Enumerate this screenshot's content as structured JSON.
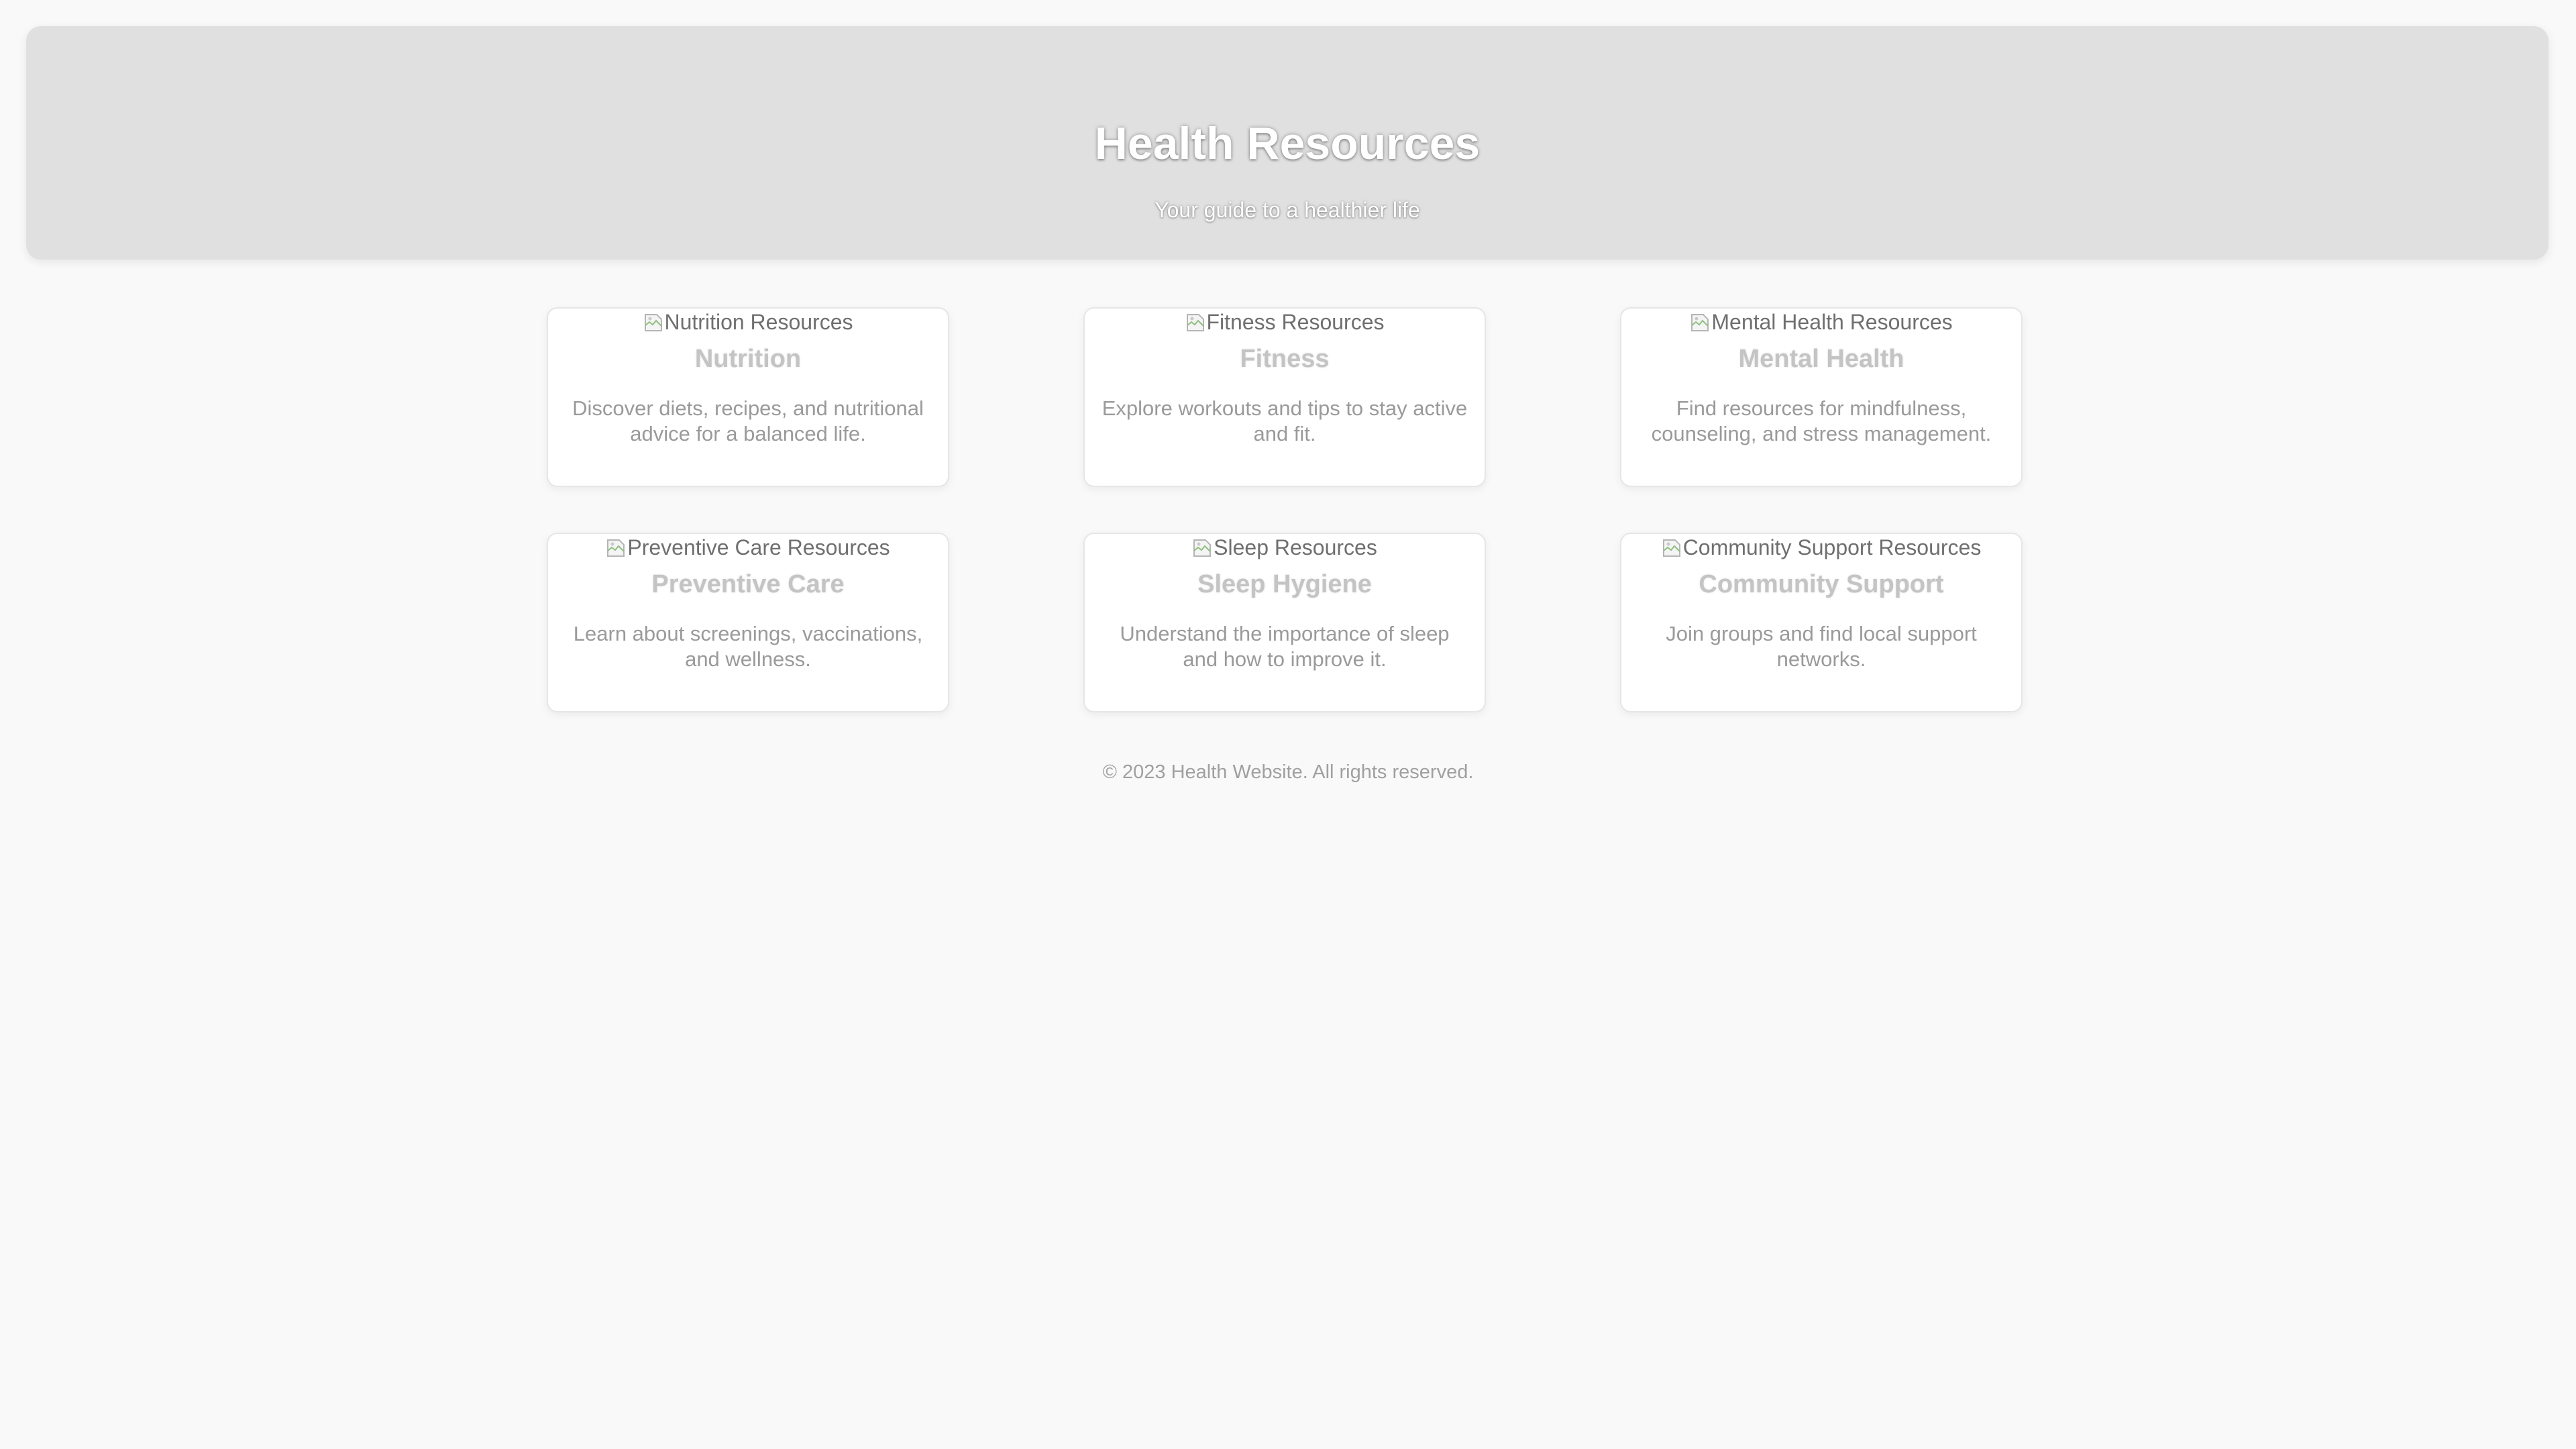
{
  "header": {
    "title": "Health Resources",
    "subtitle": "Your guide to a healthier life"
  },
  "cards": [
    {
      "image_alt": "Nutrition Resources",
      "title": "Nutrition",
      "description": "Discover diets, recipes, and nutritional advice for a balanced life."
    },
    {
      "image_alt": "Fitness Resources",
      "title": "Fitness",
      "description": "Explore workouts and tips to stay active and fit."
    },
    {
      "image_alt": "Mental Health Resources",
      "title": "Mental Health",
      "description": "Find resources for mindfulness, counseling, and stress management."
    },
    {
      "image_alt": "Preventive Care Resources",
      "title": "Preventive Care",
      "description": "Learn about screenings, vaccinations, and wellness."
    },
    {
      "image_alt": "Sleep Resources",
      "title": "Sleep Hygiene",
      "description": "Understand the importance of sleep and how to improve it."
    },
    {
      "image_alt": "Community Support Resources",
      "title": "Community Support",
      "description": "Join groups and find local support networks."
    }
  ],
  "footer": {
    "text": "© 2023 Health Website. All rights reserved."
  },
  "colors": {
    "page_background": "#f9f9f9",
    "header_background": "#e0e0e0",
    "card_background": "#ffffff"
  },
  "icons": {
    "card_image": "broken-image-icon"
  }
}
